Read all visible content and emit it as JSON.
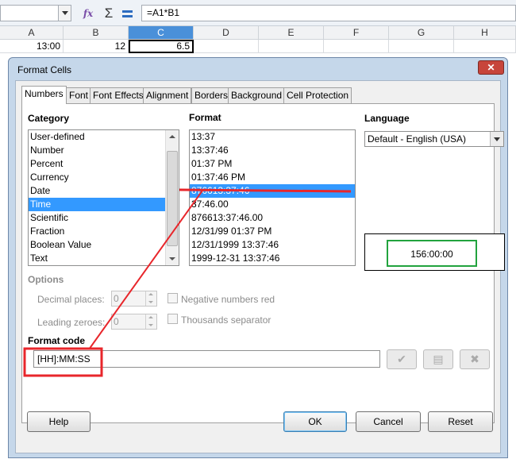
{
  "formula_bar": {
    "formula": "=A1*B1",
    "fx_icon": "function-wizard-icon",
    "sum_icon": "sum-icon",
    "equals_icon": "formula-icon"
  },
  "sheet": {
    "columns": [
      "A",
      "B",
      "C",
      "D",
      "E",
      "F",
      "G",
      "H"
    ],
    "active_column": "C",
    "row1": {
      "A": "13:00",
      "B": "12",
      "C": "6.5"
    }
  },
  "dialog": {
    "title": "Format Cells",
    "close_glyph": "✕",
    "tabs": [
      "Numbers",
      "Font",
      "Font Effects",
      "Alignment",
      "Borders",
      "Background",
      "Cell Protection"
    ],
    "active_tab": "Numbers",
    "category": {
      "heading": "Category",
      "items": [
        "User-defined",
        "Number",
        "Percent",
        "Currency",
        "Date",
        "Time",
        "Scientific",
        "Fraction",
        "Boolean Value",
        "Text"
      ],
      "selected": "Time"
    },
    "format": {
      "heading": "Format",
      "items": [
        "13:37",
        "13:37:46",
        "01:37 PM",
        "01:37:46 PM",
        "876613:37:46",
        "37:46.00",
        "876613:37:46.00",
        "12/31/99 01:37 PM",
        "12/31/1999 13:37:46",
        "1999-12-31 13:37:46"
      ],
      "selected": "876613:37:46"
    },
    "language": {
      "heading": "Language",
      "value": "Default - English (USA)"
    },
    "preview": {
      "value": "156:00:00"
    },
    "options": {
      "heading": "Options",
      "decimal_places_label": "Decimal places:",
      "decimal_places_value": "0",
      "leading_zeroes_label": "Leading zeroes:",
      "leading_zeroes_value": "0",
      "negative_red_label": "Negative numbers red",
      "thousands_separator_label": "Thousands separator"
    },
    "format_code": {
      "heading": "Format code",
      "value": "[HH]:MM:SS",
      "accept_glyph": "✔",
      "comment_glyph": "▤",
      "delete_glyph": "✖"
    },
    "buttons": {
      "help": "Help",
      "ok": "OK",
      "cancel": "Cancel",
      "reset": "Reset"
    }
  },
  "annotation_colors": {
    "red": "#e8262b",
    "green": "#22a33e"
  }
}
